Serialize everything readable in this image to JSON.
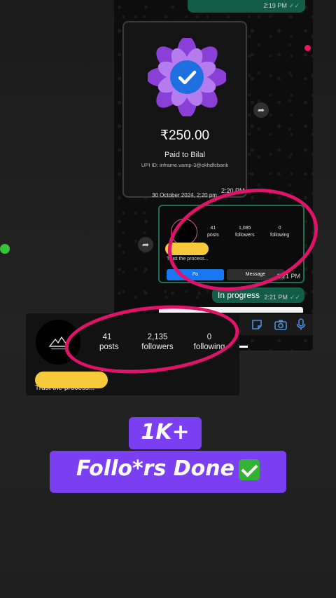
{
  "chat": {
    "top_bubble_time": "2:19 PM",
    "payment": {
      "amount": "₹250.00",
      "paid_to": "Paid to Bilal",
      "upi_id": "UPI ID: inframe.vamp-3@okhdfcbank",
      "date": "30 October 2024, 2:20 pm",
      "time": "2:20 PM"
    },
    "ig_preview": {
      "posts_count": "41",
      "posts_label": "posts",
      "followers_count": "1,085",
      "followers_label": "followers",
      "following_count": "0",
      "following_label": "following",
      "bio": "Trust the process...",
      "follow_label": "Fo",
      "message_label": "Message",
      "time": "2:21 PM"
    },
    "progress_bubble": {
      "label": "In progress",
      "time": "2:21 PM"
    }
  },
  "ig_profile": {
    "posts_count": "41",
    "posts_label": "posts",
    "followers_count": "2,135",
    "followers_label": "followers",
    "following_count": "0",
    "following_label": "following",
    "bio": "Trust the process..."
  },
  "overlay": {
    "line1": "1K+",
    "line2": "Follo*rs Done"
  },
  "colors": {
    "banner": "#7b3ff2",
    "highlight_ellipse": "#e0126a",
    "chat_bubble": "#135c48",
    "follow_button": "#1877f2",
    "check": "#34b233"
  },
  "icons": [
    "forward-icon",
    "sticker-icon",
    "camera-icon",
    "mic-icon",
    "verified-lotus-icon",
    "check-mark-icon"
  ]
}
